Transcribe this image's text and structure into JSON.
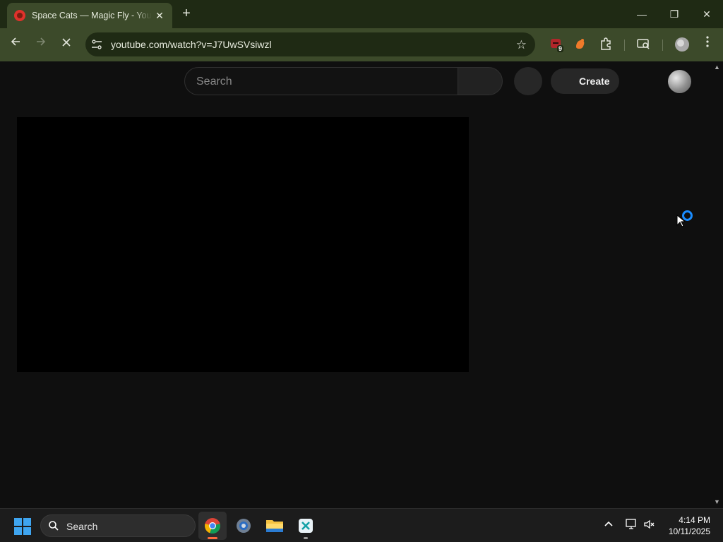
{
  "browser": {
    "tab_title": "Space Cats — Magic Fly - YouTube",
    "new_tab_label": "+",
    "url": "youtube.com/watch?v=J7UwSVsiwzl",
    "extension_badge": "9"
  },
  "youtube": {
    "search_placeholder": "Search",
    "create_label": "Create"
  },
  "taskbar": {
    "search_label": "Search",
    "time": "4:14 PM",
    "date": "10/11/2025"
  },
  "colors": {
    "frame": "#3c4a2a",
    "titlebar": "#1f2a14",
    "page_bg": "#0f0f0f",
    "spinner": "#1a8cff"
  }
}
